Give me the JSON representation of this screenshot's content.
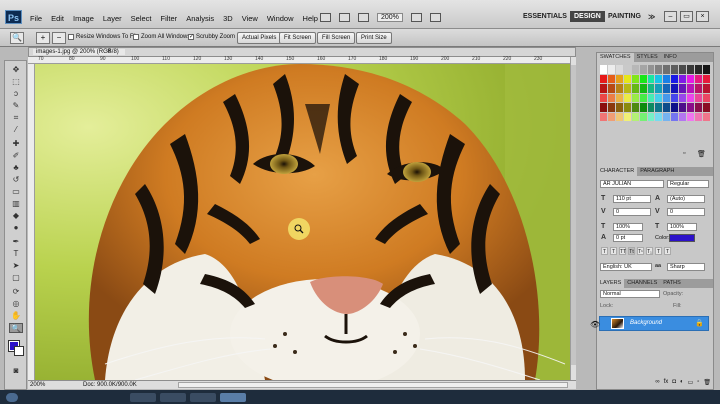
{
  "menubar": {
    "logo": "Ps",
    "items": [
      "File",
      "Edit",
      "Image",
      "Layer",
      "Select",
      "Filter",
      "Analysis",
      "3D",
      "View",
      "Window",
      "Help"
    ],
    "zoom": "200%",
    "workspaces": [
      "ESSENTIALS",
      "DESIGN",
      "PAINTING"
    ],
    "more": "≫"
  },
  "options": {
    "checks": [
      "Resize Windows To Fit",
      "Zoom All Windows",
      "Scrubby Zoom"
    ],
    "buttons": [
      "Actual Pixels",
      "Fit Screen",
      "Fill Screen",
      "Print Size"
    ]
  },
  "document": {
    "tab_title": "images-1.jpg @ 200% (RGB/8)",
    "close": "×",
    "ruler_marks": [
      "70",
      "80",
      "90",
      "100",
      "110",
      "120",
      "130",
      "140",
      "150",
      "160",
      "170",
      "180",
      "190",
      "200",
      "210",
      "220",
      "230"
    ]
  },
  "status": {
    "zoom": "200%",
    "doc": "Doc: 900.0K/900.0K"
  },
  "panels": {
    "swatch_tabs": [
      "SWATCHES",
      "STYLES",
      "INFO"
    ],
    "char_tabs": [
      "CHARACTER",
      "PARAGRAPH"
    ],
    "font_family": "AR JULIAN",
    "font_style": "Regular",
    "font_size": "110 pt",
    "leading": "(Auto)",
    "tracking": "0",
    "kerning": "0",
    "v_scale": "100%",
    "h_scale": "100%",
    "baseline": "0 pt",
    "color_label": "Color:",
    "language": "English: UK",
    "aa": "Sharp",
    "layer_tabs": [
      "LAYERS",
      "CHANNELS",
      "PATHS"
    ],
    "blend": "Normal",
    "opacity": "Opacity:",
    "fill": "Fill:",
    "lock": "Lock:",
    "layer_name": "Background"
  },
  "colors": {
    "accent": "#3a8de0",
    "foreground": "#2c11c9",
    "text_color_swatch": "#2c11c9"
  }
}
